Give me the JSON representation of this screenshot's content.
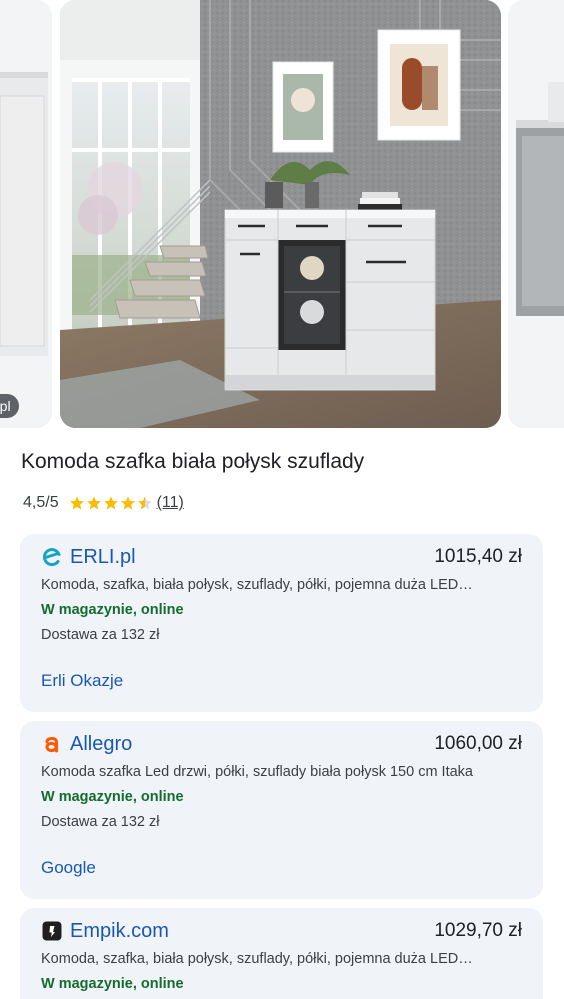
{
  "carousel": {
    "source_chip": "RLI.pl"
  },
  "product": {
    "title": "Komoda szafka biała połysk szuflady",
    "rating": "4,5/5",
    "stars": 4.5,
    "review_count": "(11)"
  },
  "colors": {
    "link_blue": "#1a57b4",
    "in_stock_green": "#146c2e",
    "offer_bg": "#f0f4f9",
    "star_gold": "#fbbc04"
  },
  "offers": [
    {
      "merchant": "ERLI.pl",
      "logo_icon": "erli-logo-icon",
      "price": "1015,40 zł",
      "description": "Komoda, szafka, biała połysk, szuflady, półki, pojemna duża LED…",
      "stock": "W magazynie, online",
      "delivery": "Dostawa za 132 zł",
      "link": "Erli Okazje"
    },
    {
      "merchant": "Allegro",
      "logo_icon": "allegro-logo-icon",
      "price": "1060,00 zł",
      "description": "Komoda szafka Led drzwi, półki, szuflady biała połysk 150 cm Itaka",
      "stock": "W magazynie, online",
      "delivery": "Dostawa za 132 zł",
      "link": "Google"
    },
    {
      "merchant": "Empik.com",
      "logo_icon": "empik-logo-icon",
      "price": "1029,70 zł",
      "description": "Komoda, szafka, biała połysk, szuflady, półki, pojemna duża LED…",
      "stock": "W magazynie, online"
    }
  ]
}
